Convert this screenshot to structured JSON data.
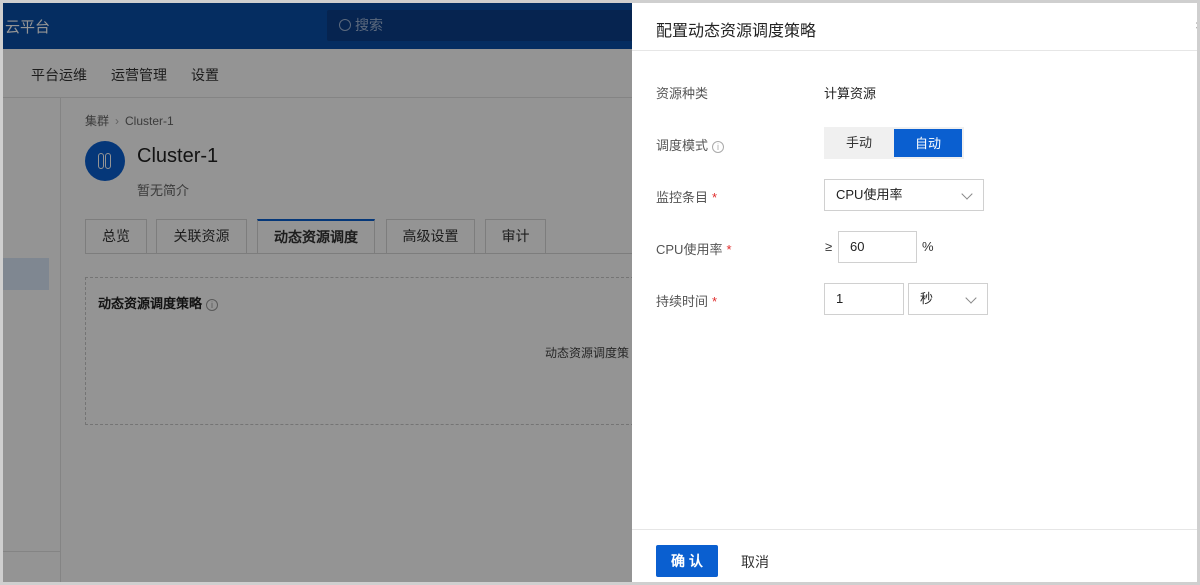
{
  "app": {
    "brand": "云平台",
    "search_placeholder": "搜索",
    "menu": [
      "平台运维",
      "运营管理",
      "设置"
    ]
  },
  "page": {
    "breadcrumb": [
      "集群",
      "Cluster-1"
    ],
    "cluster_name": "Cluster-1",
    "cluster_desc": "暂无简介",
    "tabs": [
      "总览",
      "关联资源",
      "动态资源调度",
      "高级设置",
      "审计"
    ],
    "active_tab": "动态资源调度",
    "section_title": "动态资源调度策略",
    "section_message": "动态资源调度策"
  },
  "drawer": {
    "title": "配置动态资源调度策略",
    "close_label": "×",
    "fields": {
      "resource_type": {
        "label": "资源种类",
        "value": "计算资源"
      },
      "mode": {
        "label": "调度模式",
        "info": "i",
        "options": [
          "手动",
          "自动"
        ],
        "selected": "自动"
      },
      "monitor_item": {
        "label": "监控条目",
        "required": "*",
        "value": "CPU使用率"
      },
      "cpu_usage": {
        "label": "CPU使用率",
        "required": "*",
        "operator": "≥",
        "value": "60",
        "unit": "%"
      },
      "duration": {
        "label": "持续时间",
        "required": "*",
        "value": "1",
        "unit": "秒"
      }
    },
    "confirm_label": "确 认",
    "cancel_label": "取消"
  },
  "colors": {
    "primary": "#0a5fd0",
    "topbar": "#0a4ea8",
    "required": "#e02b2b"
  }
}
